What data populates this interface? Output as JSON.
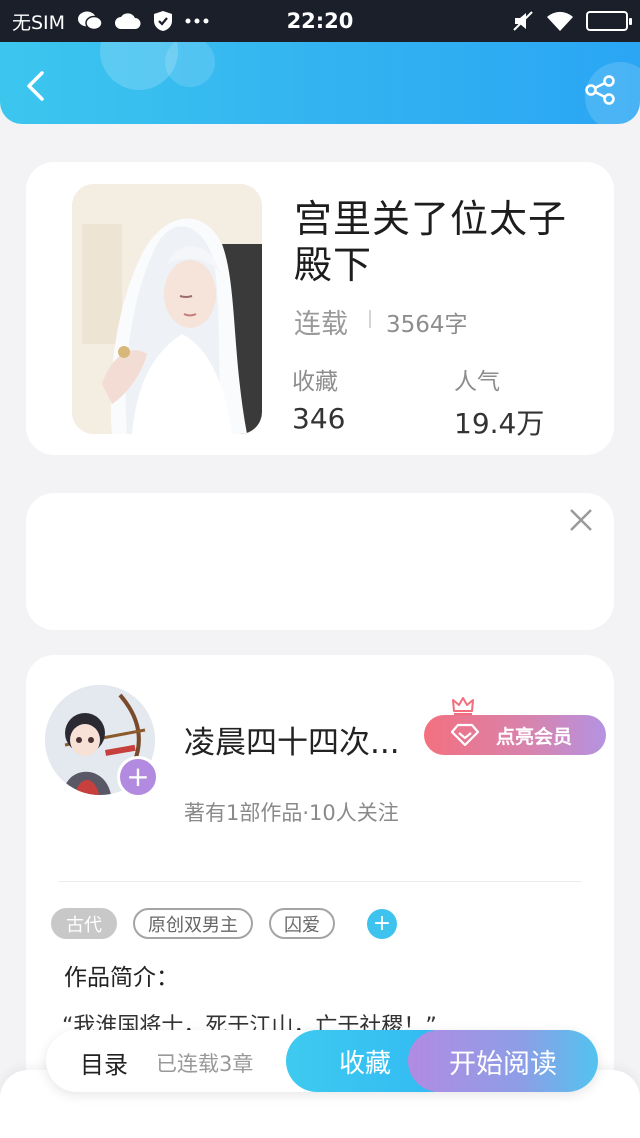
{
  "status_bar": {
    "carrier": "无SIM",
    "time": "22:20"
  },
  "header": {
    "back_icon": "chevron-left-icon",
    "share_icon": "share-icon"
  },
  "book": {
    "title": "宫里关了位太子殿下",
    "status": "连载",
    "word_count": "3564字",
    "favorites_label": "收藏",
    "favorites_value": "346",
    "popularity_label": "人气",
    "popularity_value": "19.4万"
  },
  "ad": {
    "close_icon": "close-icon"
  },
  "author": {
    "name": "凌晨四十四次...",
    "follow_icon": "+",
    "vip_button_label": "点亮会员",
    "stats": "著有1部作品·10人关注"
  },
  "tags": {
    "items": [
      "古代",
      "原创双男主",
      "囚爱"
    ],
    "add_icon": "+"
  },
  "intro": {
    "label": "作品简介：",
    "text": "“我淮国将士，死于江山，亡于社稷！”"
  },
  "bottom_bar": {
    "toc_label": "目录",
    "toc_sub": "已连载3章",
    "collect_label": "收藏",
    "read_label": "开始阅读"
  },
  "colors": {
    "accent": "#33bbf2",
    "vip_start": "#f3707f",
    "vip_end": "#b493e2",
    "follow": "#b28be0"
  }
}
